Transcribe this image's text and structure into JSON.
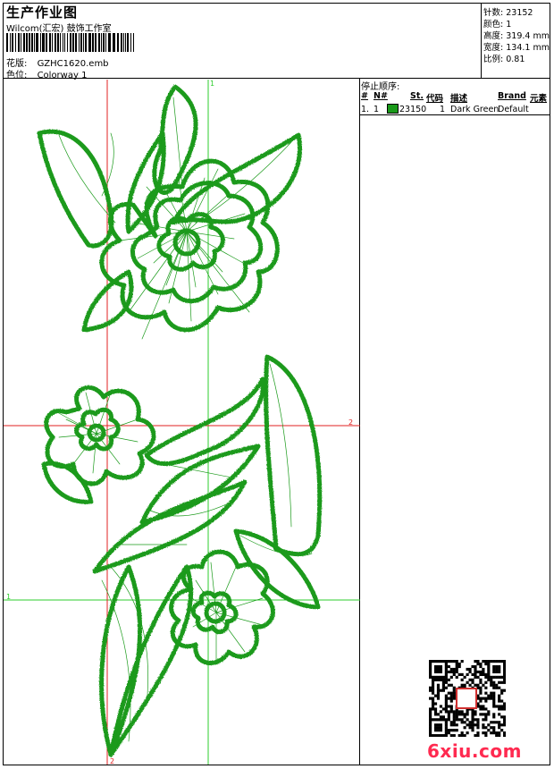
{
  "header": {
    "title": "生产作业图",
    "subtitle": "Wilcom(汇宏) 鼓饰工作室",
    "file_label": "花版:",
    "file_value": "GZHC1620.emb",
    "color_label": "色位:",
    "color_value": "Colorway 1"
  },
  "stats": [
    {
      "label": "针数:",
      "value": "23152"
    },
    {
      "label": "颜色:",
      "value": "1"
    },
    {
      "label": "高度:",
      "value": "319.4 mm"
    },
    {
      "label": "宽度:",
      "value": "134.1 mm"
    },
    {
      "label": "比例:",
      "value": "0.81"
    }
  ],
  "stop_sequence": {
    "heading": "停止顺序:",
    "columns": [
      "#",
      "N#",
      "St.",
      "代码",
      "描述",
      "Brand",
      "元素"
    ],
    "rows": [
      {
        "index": "1.",
        "needle": "1",
        "stitches": "23150",
        "code": "1",
        "description": "Dark Green",
        "brand": "Default",
        "color": "#1a9a1a"
      }
    ]
  },
  "guides": {
    "green_top": "1",
    "green_left": "1",
    "red_right": "2",
    "red_bottom": "2"
  },
  "colors": {
    "thread": "#1a9a1a",
    "guide_green": "#2ecc2e",
    "guide_red": "#e02020",
    "watermark": "#ff2a50"
  },
  "watermark": "6xiu.com"
}
